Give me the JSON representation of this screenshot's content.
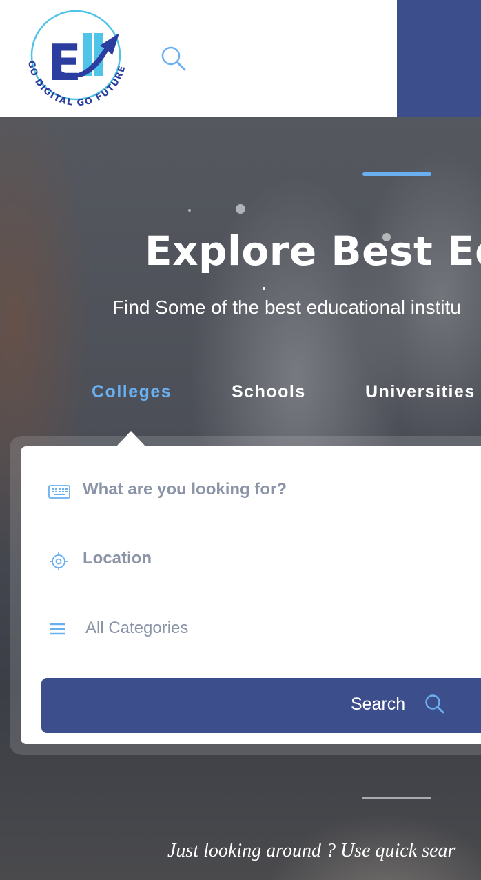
{
  "header": {
    "logo_text": "GO DIGITAL GO FUTURE",
    "search_icon": "search-icon"
  },
  "hero": {
    "title": "Explore Best Ed",
    "subtitle": "Find Some of the best educational institu"
  },
  "tabs": [
    {
      "label": "Colleges",
      "active": true
    },
    {
      "label": "Schools",
      "active": false
    },
    {
      "label": "Universities",
      "active": false
    }
  ],
  "search_form": {
    "keyword_placeholder": "What are you looking for?",
    "location_placeholder": "Location",
    "category_selected": "All Categories",
    "search_label": "Search",
    "icons": [
      "keyboard-icon",
      "location-target-icon",
      "list-icon",
      "search-icon"
    ]
  },
  "quick_search_text": "Just looking around ? Use quick sear",
  "colors": {
    "accent": "#6aaff0",
    "primary": "#3d4e8c",
    "placeholder": "#8a94a6"
  }
}
